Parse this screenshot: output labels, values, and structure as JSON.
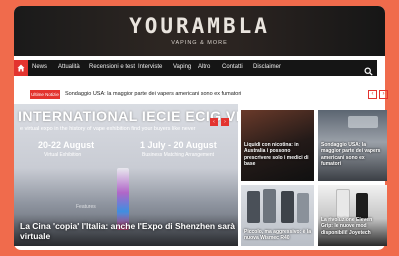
{
  "site": {
    "logo": "YOURAMBLA",
    "tagline": "VAPING & MORE"
  },
  "nav": {
    "home_icon": "home-icon",
    "items": [
      "News",
      "Attualità",
      "Recensioni e test",
      "Interviste",
      "Vaping",
      "Altro",
      "Contatti",
      "Disclaimer"
    ],
    "search_icon": "search-icon"
  },
  "ticker": {
    "badge": "Ultime Notizie",
    "text": "Sondaggio USA: la maggior parte dei vapers americani sono ex fumatori",
    "prev": "‹",
    "next": "›"
  },
  "hero": {
    "banner_title": "INTERNATIONAL IECIE ECIG VI",
    "banner_sub": "e virtual expo in the history of vape exhibition find your buyers like never",
    "date1": "20-22 August",
    "date1_sub": "Virtual Exhibition",
    "date2": "1 July - 20 August",
    "date2_sub": "Business Matching Arrangement",
    "watermark": "Features",
    "caption": "La Cina 'copia' l'Italia: anche l'Expo di Shenzhen sarà virtuale",
    "prev": "‹",
    "next": "›"
  },
  "cards": [
    {
      "title": "Liquidi con nicotina: in Australia i possono prescrivere solo i medici di base"
    },
    {
      "title": "Sondaggio USA: la maggior parte dei vapers americani sono ex fumatori"
    },
    {
      "title": "Piccolo, ma aggressivo: è la nuova Wismec R40"
    },
    {
      "title": "La rivoluzione Eleven Grip: le nuove mod disponibili! Joyetech"
    }
  ],
  "colors": {
    "page_bg": "#f06b4c",
    "accent": "#e3342f",
    "nav_bg": "#151515"
  }
}
